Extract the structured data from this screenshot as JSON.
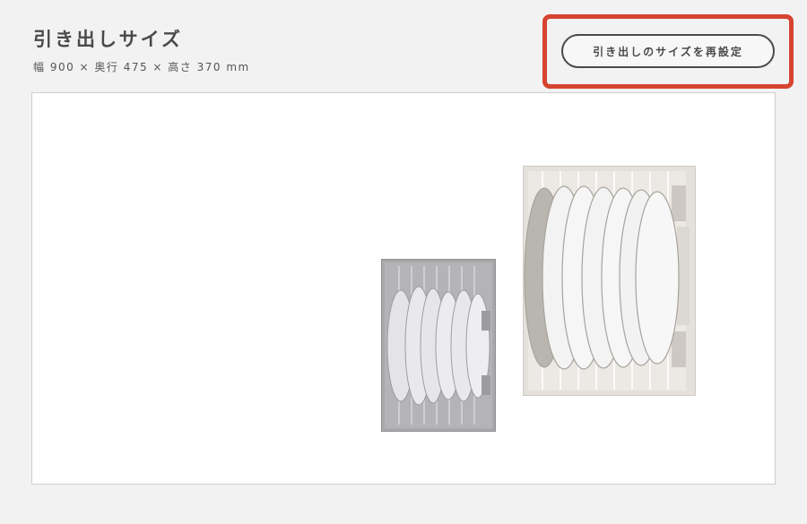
{
  "header": {
    "title": "引き出しサイズ",
    "dimensions": "幅 900 × 奥行 475 × 高さ 370 mm"
  },
  "reset_button": {
    "label": "引き出しのサイズを再設定"
  },
  "colors": {
    "background": "#f2f2f2",
    "highlight": "#d64431",
    "text": "#4a4a4a",
    "drawer": "#ffffff"
  },
  "drawer": {
    "items": [
      {
        "name": "plate-rack-small",
        "tone": "gray",
        "plates": 6
      },
      {
        "name": "plate-rack-large",
        "tone": "light",
        "plates": 7
      }
    ]
  }
}
